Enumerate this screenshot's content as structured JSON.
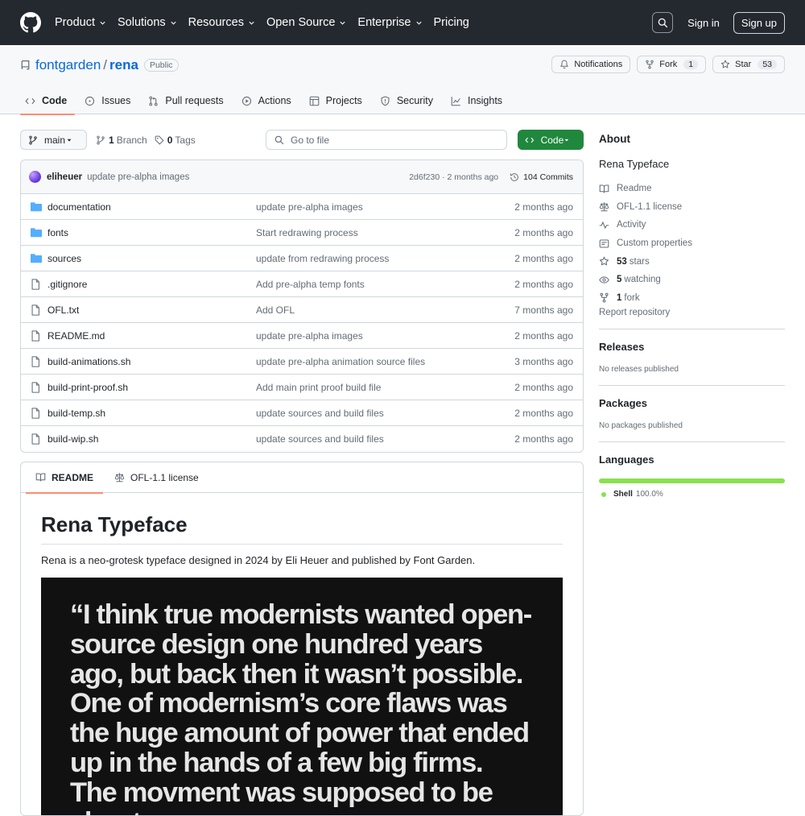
{
  "topnav": {
    "items": [
      "Product",
      "Solutions",
      "Resources",
      "Open Source",
      "Enterprise",
      "Pricing"
    ],
    "signin": "Sign in",
    "signup": "Sign up"
  },
  "repo": {
    "owner": "fontgarden",
    "name": "rena",
    "visibility": "Public",
    "notifications_label": "Notifications",
    "fork_label": "Fork",
    "fork_count": "1",
    "star_label": "Star",
    "star_count": "53"
  },
  "tabs": [
    "Code",
    "Issues",
    "Pull requests",
    "Actions",
    "Projects",
    "Security",
    "Insights"
  ],
  "toolbar": {
    "branch": "main",
    "branch_count": "1",
    "branch_label": "Branch",
    "tag_count": "0",
    "tag_label": "Tags",
    "goto_placeholder": "Go to file",
    "code_label": "Code"
  },
  "commit": {
    "author": "eliheuer",
    "message": "update pre-alpha images",
    "hash_time": "2d6f230 · 2 months ago",
    "commits_label": "104 Commits"
  },
  "files": [
    {
      "type": "dir",
      "name": "documentation",
      "message": "update pre-alpha images",
      "date": "2 months ago"
    },
    {
      "type": "dir",
      "name": "fonts",
      "message": "Start redrawing process",
      "date": "2 months ago"
    },
    {
      "type": "dir",
      "name": "sources",
      "message": "update from redrawing process",
      "date": "2 months ago"
    },
    {
      "type": "file",
      "name": ".gitignore",
      "message": "Add pre-alpha temp fonts",
      "date": "2 months ago"
    },
    {
      "type": "file",
      "name": "OFL.txt",
      "message": "Add OFL",
      "date": "7 months ago"
    },
    {
      "type": "file",
      "name": "README.md",
      "message": "update pre-alpha images",
      "date": "2 months ago"
    },
    {
      "type": "file",
      "name": "build-animations.sh",
      "message": "update pre-alpha animation source files",
      "date": "3 months ago"
    },
    {
      "type": "file",
      "name": "build-print-proof.sh",
      "message": "Add main print proof build file",
      "date": "2 months ago"
    },
    {
      "type": "file",
      "name": "build-temp.sh",
      "message": "update sources and build files",
      "date": "2 months ago"
    },
    {
      "type": "file",
      "name": "build-wip.sh",
      "message": "update sources and build files",
      "date": "2 months ago"
    }
  ],
  "readme": {
    "tab_readme": "README",
    "tab_license": "OFL-1.1 license",
    "title": "Rena Typeface",
    "intro": "Rena is a neo-grotesk typeface designed in 2024 by Eli Heuer and published by Font Garden.",
    "hero_quote": "“I think true modernists wanted open-source design one hundred years ago, but back then it wasn’t possible. One of modernism’s core flaws was the huge amount of power that ended up in the hands of a few big firms. The movment was supposed to be about"
  },
  "sidebar": {
    "about_heading": "About",
    "description": "Rena Typeface",
    "links": {
      "readme": "Readme",
      "license": "OFL-1.1 license",
      "activity": "Activity",
      "custom_properties": "Custom properties",
      "stars_count": "53",
      "stars_label": "stars",
      "watching_count": "5",
      "watching_label": "watching",
      "fork_count": "1",
      "fork_label": "fork"
    },
    "report": "Report repository",
    "releases_heading": "Releases",
    "releases_text": "No releases published",
    "packages_heading": "Packages",
    "packages_text": "No packages published",
    "languages_heading": "Languages",
    "language": {
      "name": "Shell",
      "percent": "100.0%",
      "color": "#89e051",
      "fraction": 1.0
    }
  },
  "colors": {
    "header_bg": "#24292f",
    "accent_link": "#0969da",
    "code_button": "#1f883d",
    "folder_icon": "#54aeff",
    "tab_underline": "#fd8c73"
  }
}
